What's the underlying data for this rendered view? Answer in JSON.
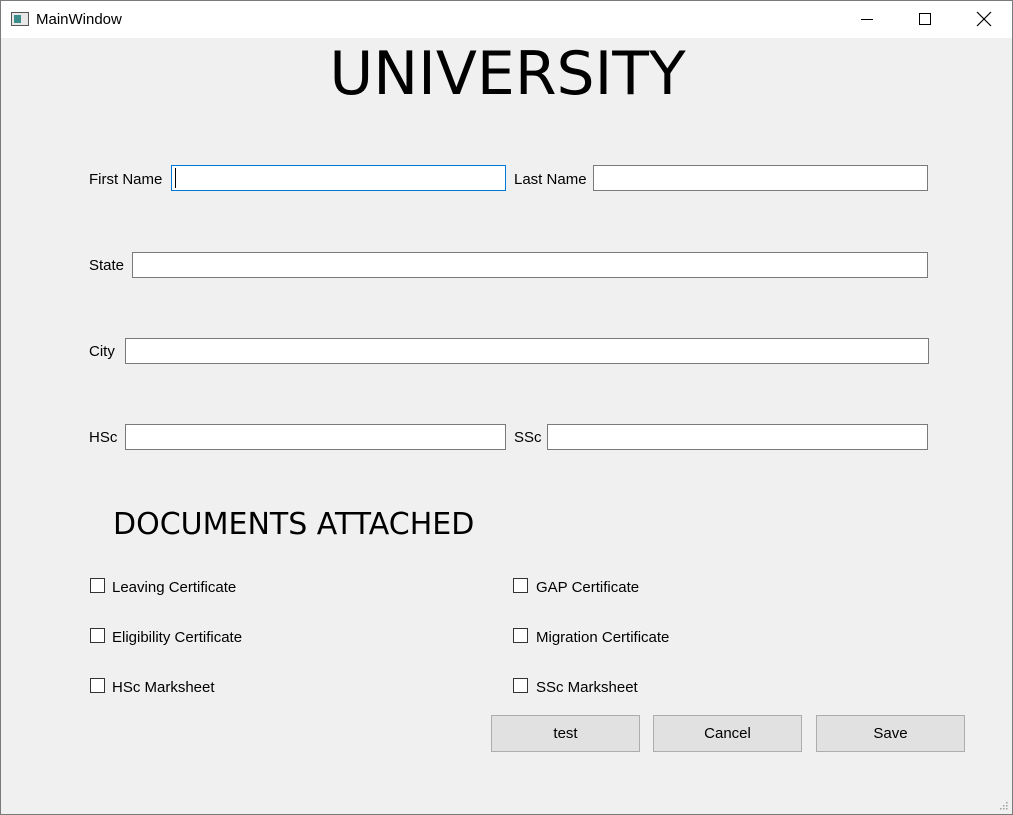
{
  "window": {
    "title": "MainWindow"
  },
  "heading": "UNIVERSITY",
  "form": {
    "first_name": {
      "label": "First Name",
      "value": ""
    },
    "last_name": {
      "label": "Last Name",
      "value": ""
    },
    "state": {
      "label": "State",
      "value": ""
    },
    "city": {
      "label": "City",
      "value": ""
    },
    "hsc": {
      "label": "HSc",
      "value": ""
    },
    "ssc": {
      "label": "SSc",
      "value": ""
    }
  },
  "documents": {
    "heading": "DOCUMENTS ATTACHED",
    "items": [
      {
        "label": "Leaving Certificate",
        "checked": false
      },
      {
        "label": "GAP Certificate",
        "checked": false
      },
      {
        "label": "Eligibility Certificate",
        "checked": false
      },
      {
        "label": "Migration Certificate",
        "checked": false
      },
      {
        "label": "HSc Marksheet",
        "checked": false
      },
      {
        "label": "SSc Marksheet",
        "checked": false
      }
    ]
  },
  "buttons": {
    "test": "test",
    "cancel": "Cancel",
    "save": "Save"
  },
  "colors": {
    "window_bg": "#f0f0f0",
    "focus_border": "#0078d7",
    "button_bg": "#e1e1e1"
  },
  "icons": [
    "app-icon",
    "minimize-icon",
    "maximize-icon",
    "close-icon",
    "resize-grip-icon"
  ]
}
